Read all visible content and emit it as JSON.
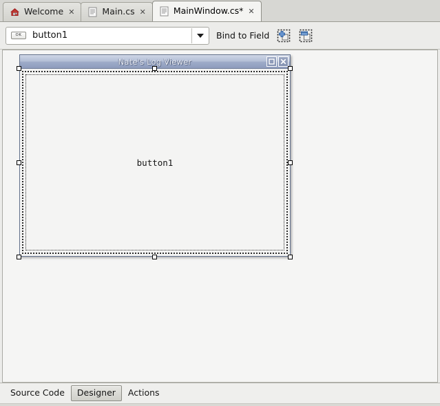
{
  "colors": {
    "accent_title_start": "#cfd6e6",
    "accent_title_end": "#8e9cbd",
    "canvas_bg": "#f5f5f4",
    "chrome_bg": "#ececea",
    "tabstrip_bg": "#d7d7d3",
    "icon_blue": "#3f6fb5",
    "home_icon_red": "#a32020"
  },
  "tabstrip": {
    "tabs": [
      {
        "label": "Welcome",
        "icon": "home-icon",
        "close": "✕",
        "active": false
      },
      {
        "label": "Main.cs",
        "icon": "document-icon",
        "close": "✕",
        "active": false
      },
      {
        "label": "MainWindow.cs*",
        "icon": "document-icon",
        "close": "✕",
        "active": true
      }
    ]
  },
  "toolbar": {
    "widget_combo": {
      "icon_label": "OK",
      "icon_name": "button-widget-icon",
      "value": "button1",
      "arrow_icon": "chevron-down-icon"
    },
    "bind_to_field_label": "Bind to Field",
    "buttons": [
      {
        "name": "add-field-binding-button",
        "icon": "add-field-icon"
      },
      {
        "name": "remove-field-binding-button",
        "icon": "remove-field-icon"
      }
    ]
  },
  "designer": {
    "form": {
      "title": "Nate's Log Viewer",
      "titlebar_buttons": [
        {
          "name": "form-maximize-button",
          "icon": "maximize-icon"
        },
        {
          "name": "form-close-button",
          "icon": "close-icon"
        }
      ],
      "widgets": [
        {
          "name": "button1",
          "type": "Button",
          "label": "button1",
          "selected": true
        }
      ]
    }
  },
  "bottom_tabs": {
    "items": [
      {
        "label": "Source Code",
        "selected": false
      },
      {
        "label": "Designer",
        "selected": true
      },
      {
        "label": "Actions",
        "selected": false
      }
    ]
  }
}
